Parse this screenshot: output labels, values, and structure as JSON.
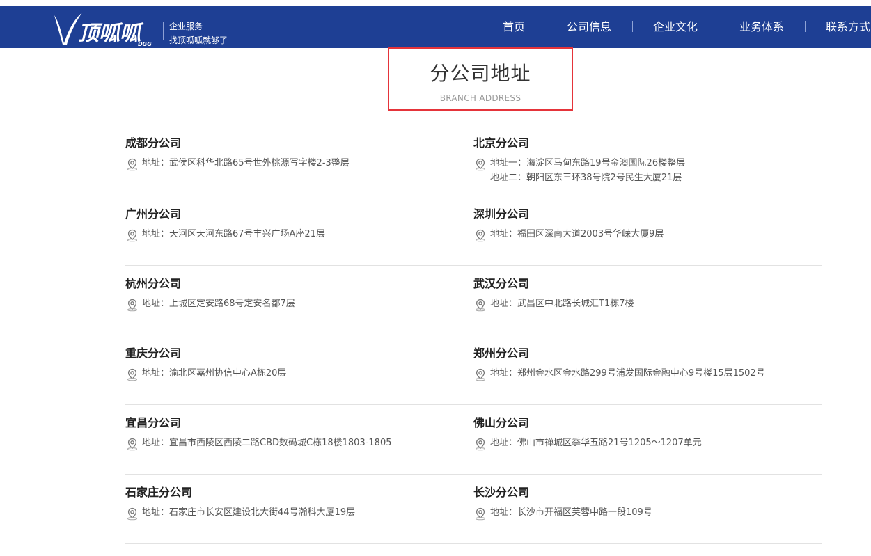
{
  "header": {
    "logo_text": "顶呱呱",
    "logo_sub": "DGG",
    "tagline_1": "企业服务",
    "tagline_2": "找顶呱呱就够了",
    "nav": [
      "首页",
      "公司信息",
      "企业文化",
      "业务体系",
      "联系方式"
    ]
  },
  "section": {
    "title": "分公司地址",
    "subtitle": "BRANCH ADDRESS"
  },
  "rows": [
    [
      {
        "name": "成都分公司",
        "addr": [
          "地址：武侯区科华北路65号世外桃源写字楼2-3整层"
        ]
      },
      {
        "name": "北京分公司",
        "addr": [
          "地址一：海淀区马甸东路19号金澳国际26楼整层",
          "地址二：朝阳区东三环38号院2号民生大厦21层"
        ]
      }
    ],
    [
      {
        "name": "广州分公司",
        "addr": [
          "地址：天河区天河东路67号丰兴广场A座21层"
        ]
      },
      {
        "name": "深圳分公司",
        "addr": [
          "地址：福田区深南大道2003号华嵘大厦9层"
        ]
      }
    ],
    [
      {
        "name": "杭州分公司",
        "addr": [
          "地址：上城区定安路68号定安名都7层"
        ]
      },
      {
        "name": "武汉分公司",
        "addr": [
          "地址：武昌区中北路长城汇T1栋7楼"
        ]
      }
    ],
    [
      {
        "name": "重庆分公司",
        "addr": [
          "地址：渝北区嘉州协信中心A栋20层"
        ]
      },
      {
        "name": "郑州分公司",
        "addr": [
          "地址：郑州金水区金水路299号浦发国际金融中心9号楼15层1502号"
        ]
      }
    ],
    [
      {
        "name": "宜昌分公司",
        "addr": [
          "地址：宜昌市西陵区西陵二路CBD数码城C栋18楼1803-1805"
        ]
      },
      {
        "name": "佛山分公司",
        "addr": [
          "地址：佛山市禅城区季华五路21号1205～1207单元"
        ]
      }
    ],
    [
      {
        "name": "石家庄分公司",
        "addr": [
          "地址：石家庄市长安区建设北大街44号瀚科大厦19层"
        ]
      },
      {
        "name": "长沙分公司",
        "addr": [
          "地址：长沙市开福区芙蓉中路一段109号"
        ]
      }
    ]
  ],
  "colors": {
    "header_bg": "#1e3f94",
    "title_border": "#e5343a",
    "divider": "#e2e2e2"
  }
}
